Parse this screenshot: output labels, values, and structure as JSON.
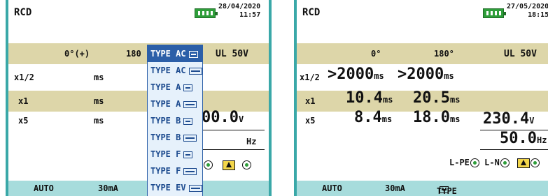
{
  "left": {
    "title": "RCD",
    "clock": {
      "date": "28/04/2020",
      "time": "11:57"
    },
    "header": {
      "col1": "0°(+)",
      "col2": "180",
      "ul": "UL 50V"
    },
    "rows": [
      {
        "label": "x1/2",
        "v1": "ms"
      },
      {
        "label": "x1",
        "v1": "ms"
      },
      {
        "label": "x5",
        "v1": "ms"
      }
    ],
    "voltage": {
      "value": "00.0",
      "unit": "V"
    },
    "hz": "Hz",
    "footer": {
      "mode": "AUTO",
      "current": "30mA"
    },
    "dropdown": [
      {
        "label": "TYPE AC",
        "icon": "ac-sine-icon",
        "selected": true
      },
      {
        "label": "TYPE AC",
        "icon": "ac-sine-double-icon",
        "selected": false
      },
      {
        "label": "TYPE A",
        "icon": "a-pulse-icon",
        "selected": false
      },
      {
        "label": "TYPE A",
        "icon": "a-pulse-double-icon",
        "selected": false
      },
      {
        "label": "TYPE B",
        "icon": "b-dc-icon",
        "selected": false
      },
      {
        "label": "TYPE B",
        "icon": "b-dc-double-icon",
        "selected": false
      },
      {
        "label": "TYPE F",
        "icon": "f-mixed-icon",
        "selected": false
      },
      {
        "label": "TYPE F",
        "icon": "f-mixed-double-icon",
        "selected": false
      },
      {
        "label": "TYPE EV",
        "icon": "ev-icon",
        "selected": false
      }
    ]
  },
  "right": {
    "title": "RCD",
    "clock": {
      "date": "27/05/2020",
      "time": "18:15"
    },
    "header": {
      "col1": "0°",
      "col2": "180°",
      "ul": "UL 50V"
    },
    "rows": [
      {
        "label": "x1/2",
        "v1": ">2000",
        "u1": "ms",
        "v2": ">2000",
        "u2": "ms"
      },
      {
        "label": "x1",
        "v1": "10.4",
        "u1": "ms",
        "v2": "20.5",
        "u2": "ms"
      },
      {
        "label": "x5",
        "v1": "8.4",
        "u1": "ms",
        "v2": "18.0",
        "u2": "ms"
      }
    ],
    "voltage": {
      "value": "230.4",
      "unit": "V"
    },
    "freq": {
      "value": "50.0",
      "unit": "Hz"
    },
    "indicators": {
      "lpe": "L-PE",
      "ln": "L-N"
    },
    "footer": {
      "mode": "AUTO",
      "current": "30mA",
      "type": "TYPE AC"
    }
  }
}
